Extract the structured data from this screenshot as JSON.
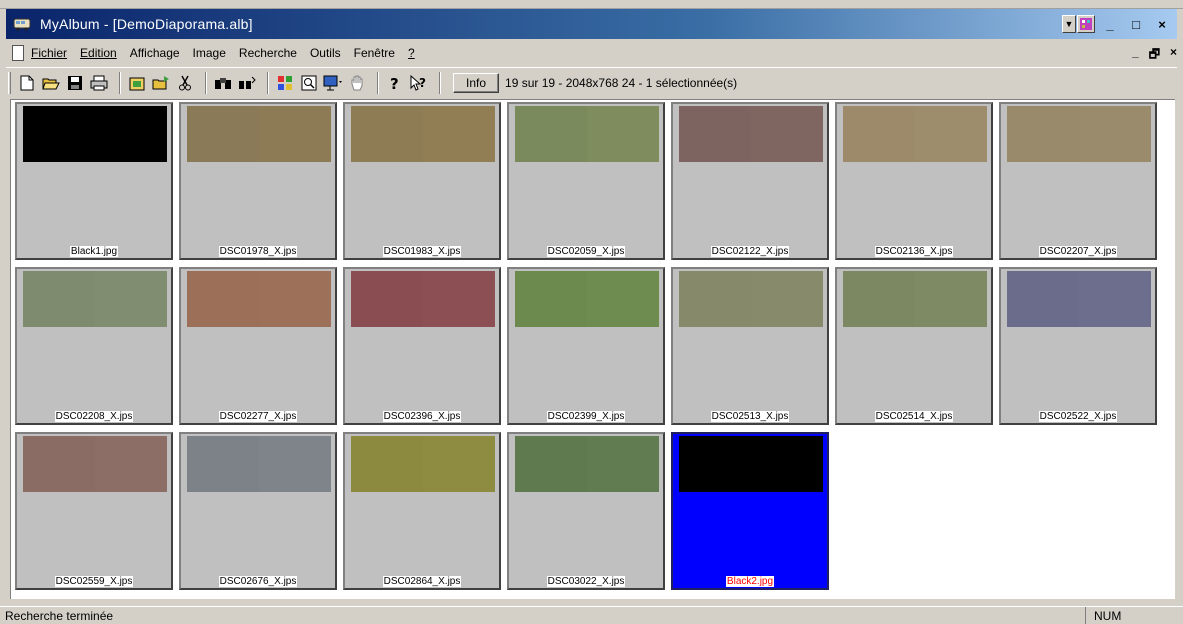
{
  "window": {
    "title": "MyAlbum - [DemoDiaporama.alb]",
    "app_icon": "bus-icon",
    "controls": [
      "_",
      "□",
      "×"
    ]
  },
  "menu": {
    "items": [
      {
        "label": "Fichier"
      },
      {
        "label": "Edition"
      },
      {
        "label": "Affichage"
      },
      {
        "label": "Image"
      },
      {
        "label": "Recherche"
      },
      {
        "label": "Outils"
      },
      {
        "label": "Fenêtre"
      },
      {
        "label": "?"
      }
    ],
    "mdi_controls": [
      "_",
      "🗗",
      "×"
    ]
  },
  "toolbar": {
    "tools": [
      "new-icon",
      "open-icon",
      "save-icon",
      "print-icon",
      "import-icon",
      "export-icon",
      "cut-icon",
      "find-icon",
      "find-similar-icon",
      "color-grid-icon",
      "zoom-icon",
      "slideshow-icon",
      "hand-icon",
      "help-icon",
      "context-help-icon"
    ],
    "info_label": "Info",
    "info_text": "19 sur 19 - 2048x768 24 - 1 sélectionnée(s)"
  },
  "thumbnails": [
    {
      "name": "Black1.jpg",
      "colors": [
        "#000000",
        "#000000"
      ],
      "selected": false
    },
    {
      "name": "DSC01978_X.jps",
      "colors": [
        "#8a7a58",
        "#8d7b56"
      ],
      "selected": false
    },
    {
      "name": "DSC01983_X.jps",
      "colors": [
        "#8e7c55",
        "#927e54"
      ],
      "selected": false
    },
    {
      "name": "DSC02059_X.jps",
      "colors": [
        "#7b8a5c",
        "#7f8c5e"
      ],
      "selected": false
    },
    {
      "name": "DSC02122_X.jps",
      "colors": [
        "#7d6460",
        "#806661"
      ],
      "selected": false
    },
    {
      "name": "DSC02136_X.jps",
      "colors": [
        "#9c8a6a",
        "#9e8d6c"
      ],
      "selected": false
    },
    {
      "name": "DSC02207_X.jps",
      "colors": [
        "#9a8a6c",
        "#9a8b6d"
      ],
      "selected": false
    },
    {
      "name": "DSC02208_X.jps",
      "colors": [
        "#7f8b6e",
        "#818d70"
      ],
      "selected": false
    },
    {
      "name": "DSC02277_X.jps",
      "colors": [
        "#9b6f58",
        "#9d7059"
      ],
      "selected": false
    },
    {
      "name": "DSC02396_X.jps",
      "colors": [
        "#8a4e52",
        "#8c5054"
      ],
      "selected": false
    },
    {
      "name": "DSC02399_X.jps",
      "colors": [
        "#6c8a4e",
        "#6e8b50"
      ],
      "selected": false
    },
    {
      "name": "DSC02513_X.jps",
      "colors": [
        "#868a6a",
        "#888b6b"
      ],
      "selected": false
    },
    {
      "name": "DSC02514_X.jps",
      "colors": [
        "#7b8862",
        "#7d8a64"
      ],
      "selected": false
    },
    {
      "name": "DSC02522_X.jps",
      "colors": [
        "#6b6b8c",
        "#6d6d8e"
      ],
      "selected": false
    },
    {
      "name": "DSC02559_X.jps",
      "colors": [
        "#8a6c64",
        "#8c6e66"
      ],
      "selected": false
    },
    {
      "name": "DSC02676_X.jps",
      "colors": [
        "#7c8288",
        "#7e848a"
      ],
      "selected": false
    },
    {
      "name": "DSC02864_X.jps",
      "colors": [
        "#8c8a3e",
        "#8e8c40"
      ],
      "selected": false
    },
    {
      "name": "DSC03022_X.jps",
      "colors": [
        "#5e7a4e",
        "#607c50"
      ],
      "selected": false
    },
    {
      "name": "Black2.jpg",
      "colors": [
        "#000000",
        "#000000"
      ],
      "selected": true
    }
  ],
  "status": {
    "text": "Recherche terminée",
    "num": "NUM"
  }
}
